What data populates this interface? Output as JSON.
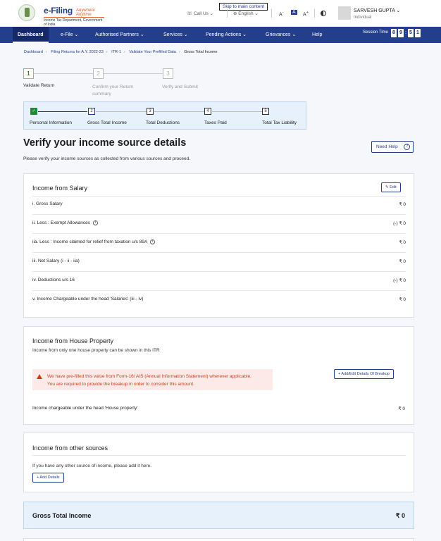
{
  "header": {
    "logo_title": "e-Filing",
    "logo_hindi": "Anywhere Anytime",
    "logo_sub": "Income Tax Department, Government of India",
    "skip": "Skip to main content",
    "call": "Call Us",
    "language": "English",
    "font_small": "A",
    "font_normal": "A",
    "font_large": "A",
    "user_name": "SARVESH GUPTA",
    "user_role": "Individual"
  },
  "nav": {
    "items": [
      "Dashboard",
      "e-File",
      "Authorised Partners",
      "Services",
      "Pending Actions",
      "Grievances",
      "Help"
    ],
    "session_label": "Session Time",
    "session_digits": [
      "8",
      "9",
      "5",
      "1"
    ]
  },
  "breadcrumb": [
    "Dashboard",
    "Filing Returns for A.Y. 2022-23",
    "ITR-1",
    "Validate Your Prefilled Data",
    "Gross Total Income"
  ],
  "steps": [
    {
      "num": "1",
      "label": "Validate Return"
    },
    {
      "num": "2",
      "label": "Confirm your Return summary"
    },
    {
      "num": "3",
      "label": "Verify and Submit"
    }
  ],
  "substeps": [
    {
      "num": "✓",
      "label": "Personal Information"
    },
    {
      "num": "2",
      "label": "Gross Total Income"
    },
    {
      "num": "3",
      "label": "Total Deductions"
    },
    {
      "num": "4",
      "label": "Taxes Paid"
    },
    {
      "num": "5",
      "label": "Total Tax Liability"
    }
  ],
  "page": {
    "title": "Verify your income source details",
    "description": "Please verify your income sources as collected from various sources and proceed.",
    "need_help": "Need Help",
    "help_q": "?"
  },
  "salary": {
    "title": "Income from Salary",
    "edit": "Edit",
    "rows": [
      {
        "label": "i. Gross Salary",
        "value": "₹ 0"
      },
      {
        "label": "ii. Less : Exempt Allowances",
        "value": "(-) ₹ 0"
      },
      {
        "label": "iia. Less : Income claimed for relief from taxation u/s 89A",
        "value": "₹ 0"
      },
      {
        "label": "iii. Net Salary (i - ii - iia)",
        "value": "₹ 0"
      },
      {
        "label": "iv. Deductions u/s 16",
        "value": "(-) ₹ 0"
      },
      {
        "label": "v. Income Chargeable under the head 'Salaries' (iii - iv)",
        "value": "₹ 0"
      }
    ],
    "info": "i"
  },
  "house": {
    "title": "Income from House Property",
    "subtitle": "Income from only one house property can be shown in this ITR",
    "button": "+ Add/Edit Details Of Breakup",
    "warning_line1": "We have pre-filled this value from Form-16/ AIS (Annual Information Statement) wherever applicable.",
    "warning_line2": "You are required to provide the breakup in order to consider this amount.",
    "row_label": "Income chargeable under the head 'House property'",
    "row_value": "₹ 0"
  },
  "other": {
    "title": "Income from other sources",
    "subtitle": "If you have any other source of income, please add it here.",
    "button": "+ Add Details"
  },
  "gross": {
    "label": "Gross Total Income",
    "value": "₹ 0"
  }
}
